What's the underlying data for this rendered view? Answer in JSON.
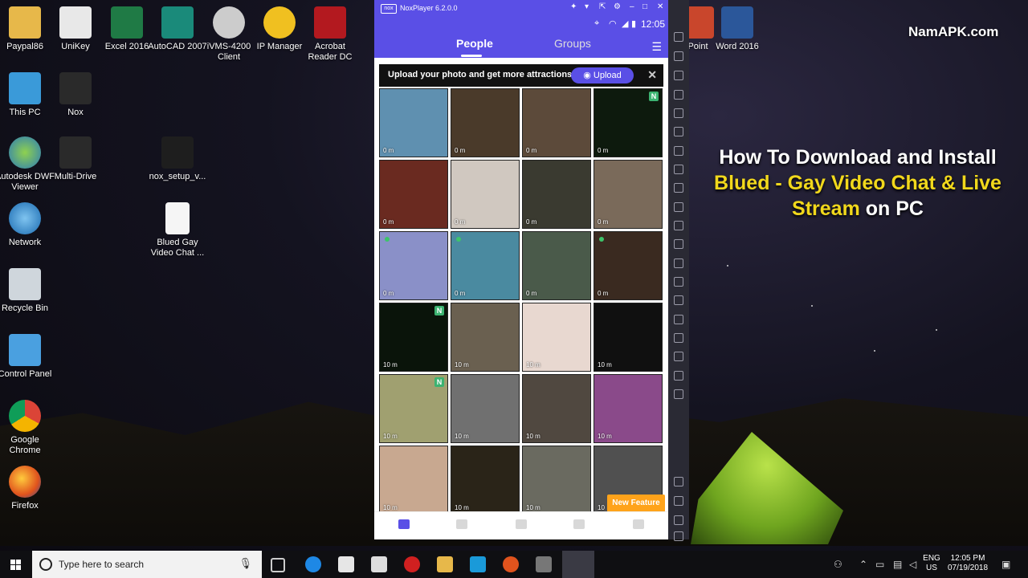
{
  "desktop": {
    "icons_col1": [
      {
        "label": "Paypal86"
      },
      {
        "label": "This PC"
      },
      {
        "label": "Autodesk DWF Viewer"
      },
      {
        "label": "Network"
      },
      {
        "label": "Recycle Bin"
      },
      {
        "label": "Control Panel"
      },
      {
        "label": "Google Chrome"
      },
      {
        "label": "Firefox"
      }
    ],
    "icons_col2": [
      {
        "label": "UniKey"
      },
      {
        "label": "Nox"
      },
      {
        "label": "Multi-Drive"
      }
    ],
    "icons_top": [
      {
        "label": "Excel 2016"
      },
      {
        "label": "AutoCAD 2007"
      },
      {
        "label": "iVMS-4200 Client"
      },
      {
        "label": "IP Manager"
      },
      {
        "label": "Acrobat Reader DC"
      }
    ],
    "icons_mid": [
      {
        "label": "nox_setup_v..."
      },
      {
        "label": "Blued Gay Video Chat ..."
      }
    ],
    "icons_right": [
      {
        "label": "Point"
      },
      {
        "label": "Word 2016"
      }
    ]
  },
  "nox": {
    "title": "NoxPlayer 6.2.0.0",
    "logo": "nox",
    "time": "12:05",
    "tabs": [
      {
        "label": "People"
      },
      {
        "label": "Groups"
      }
    ],
    "banner": {
      "text": "Upload your photo and get more attractions!",
      "button": "Upload"
    },
    "new_feature": "New Feature",
    "tiles": [
      {
        "dist": "0 m",
        "n": false,
        "online": false,
        "color": "#5f90b0"
      },
      {
        "dist": "0 m",
        "n": false,
        "online": false,
        "color": "#4a3a2a"
      },
      {
        "dist": "0 m",
        "n": false,
        "online": false,
        "color": "#5c4a3a"
      },
      {
        "dist": "0 m",
        "n": true,
        "online": false,
        "color": "#0d1a0d"
      },
      {
        "dist": "0 m",
        "n": false,
        "online": false,
        "color": "#6a2a20"
      },
      {
        "dist": "0 m",
        "n": false,
        "online": false,
        "color": "#d0c8c0"
      },
      {
        "dist": "0 m",
        "n": false,
        "online": false,
        "color": "#3a3a30"
      },
      {
        "dist": "0 m",
        "n": false,
        "online": false,
        "color": "#7a6a5a"
      },
      {
        "dist": "0 m",
        "n": false,
        "online": true,
        "color": "#8a90c8"
      },
      {
        "dist": "0 m",
        "n": false,
        "online": true,
        "color": "#4a8aa0"
      },
      {
        "dist": "0 m",
        "n": false,
        "online": false,
        "color": "#4a5a4a"
      },
      {
        "dist": "0 m",
        "n": false,
        "online": true,
        "color": "#3a2a20"
      },
      {
        "dist": "10 m",
        "n": true,
        "online": false,
        "color": "#0a140a"
      },
      {
        "dist": "10 m",
        "n": false,
        "online": false,
        "color": "#6a6050"
      },
      {
        "dist": "10 m",
        "n": false,
        "online": false,
        "color": "#e8d8d0"
      },
      {
        "dist": "10 m",
        "n": false,
        "online": false,
        "color": "#101010"
      },
      {
        "dist": "10 m",
        "n": true,
        "online": false,
        "color": "#a0a070"
      },
      {
        "dist": "10 m",
        "n": false,
        "online": false,
        "color": "#707070"
      },
      {
        "dist": "10 m",
        "n": false,
        "online": false,
        "color": "#504840"
      },
      {
        "dist": "10 m",
        "n": false,
        "online": false,
        "color": "#8a4a8a"
      },
      {
        "dist": "10 m",
        "n": false,
        "online": false,
        "color": "#c8a890"
      },
      {
        "dist": "10 m",
        "n": false,
        "online": false,
        "color": "#2a2418"
      },
      {
        "dist": "10 m",
        "n": false,
        "online": false,
        "color": "#6a6a60"
      },
      {
        "dist": "10",
        "n": false,
        "online": false,
        "color": "#505050"
      }
    ]
  },
  "overlay": {
    "brand": "NamAPK.com",
    "headline_line1": "How To Download and Install",
    "headline_hl": "Blued - Gay Video Chat & Live Stream",
    "headline_end": "on PC"
  },
  "taskbar": {
    "search_placeholder": "Type here to search",
    "lang": "ENG",
    "region": "US",
    "time": "12:05 PM",
    "date": "07/19/2018"
  },
  "colors": {
    "accent": "#5a4fe6",
    "highlight": "#f1d81c",
    "new_feature": "#ffa31a"
  }
}
